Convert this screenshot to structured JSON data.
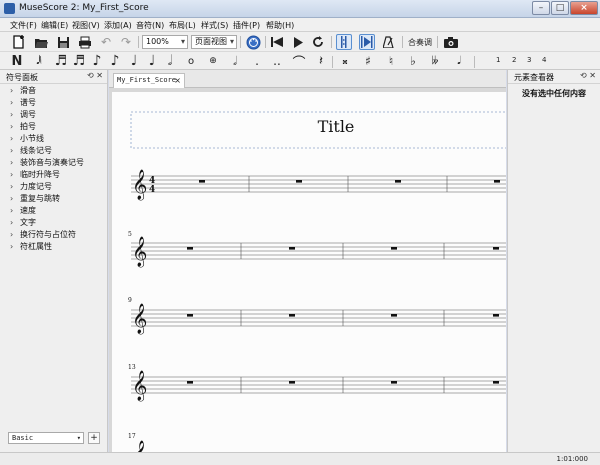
{
  "window": {
    "title": "MuseScore 2: My_First_Score"
  },
  "menu": [
    "文件(F)",
    "编辑(E)",
    "视图(V)",
    "添加(A)",
    "音符(N)",
    "布局(L)",
    "样式(S)",
    "插件(P)",
    "帮助(H)"
  ],
  "toolbar": {
    "zoom_value": "100%",
    "view_mode": "页面视图",
    "concert_pitch_label": "合奏调"
  },
  "voices": [
    "1",
    "2",
    "3",
    "4"
  ],
  "palette": {
    "title": "符号面板",
    "items": [
      "滑音",
      "谱号",
      "调号",
      "拍号",
      "小节线",
      "线条记号",
      "装饰音与演奏记号",
      "临时升降号",
      "力度记号",
      "重复与跳转",
      "速度",
      "文字",
      "换行符与占位符",
      "符杠属性"
    ],
    "workspace": "Basic",
    "add_label": "+"
  },
  "tabs": [
    {
      "label": "My_First_Score"
    }
  ],
  "score": {
    "title": "Title",
    "time_signature": [
      "4",
      "4"
    ],
    "measure_numbers": [
      "5",
      "9",
      "13",
      "17"
    ]
  },
  "inspector": {
    "title": "元素查看器",
    "empty_message": "没有选中任何内容"
  },
  "status": {
    "time": "1:01:000"
  }
}
